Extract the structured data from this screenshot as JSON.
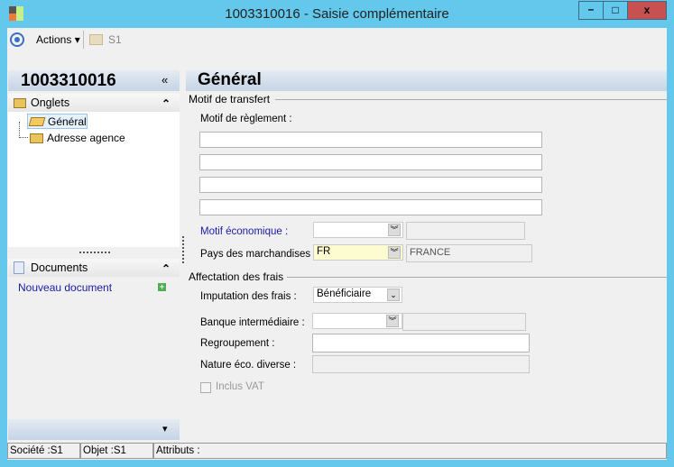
{
  "window": {
    "title": "1003310016 -  Saisie complémentaire",
    "minimize": "–",
    "maximize": "□",
    "close": "x"
  },
  "toolbar": {
    "actions": "Actions",
    "actions_arrow": "▾",
    "folder": "S1"
  },
  "left": {
    "title": "1003310016",
    "collapse": "«",
    "onglets": "Onglets",
    "onglets_toggle": "⌃",
    "tree": [
      {
        "label": "Général"
      },
      {
        "label": "Adresse agence"
      }
    ],
    "documents": "Documents",
    "documents_toggle": "⌃",
    "new_doc": "Nouveau document",
    "bottom_arrow": "▾"
  },
  "main": {
    "title": "Général",
    "sec1": "Motif de transfert",
    "motif_reglement": "Motif de règlement :",
    "motif_eco": "Motif économique :",
    "pays": "Pays des marchandises :",
    "pays_code": "FR",
    "pays_name": "FRANCE",
    "sec2": "Affectation des frais",
    "imputation": "Imputation des frais :",
    "imputation_value": "Bénéficiaire",
    "banque": "Banque intermédiaire :",
    "regroupement": "Regroupement :",
    "nature": "Nature éco. diverse :",
    "vat": "Inclus VAT"
  },
  "status": {
    "societe": "Société :S1",
    "objet": "Objet :S1",
    "attributs": "Attributs :"
  }
}
